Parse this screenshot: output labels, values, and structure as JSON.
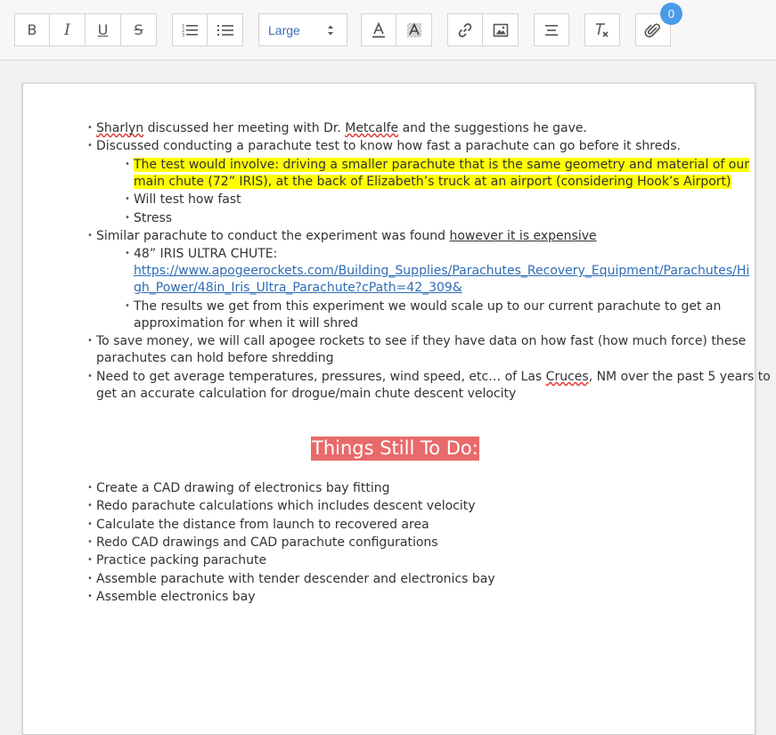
{
  "toolbar": {
    "format_size": "Large",
    "attachment_count": "0",
    "icons": [
      "bold-icon",
      "italic-icon",
      "underline-icon",
      "strikethrough-icon",
      "ordered-list-icon",
      "unordered-list-icon",
      "text-color-icon",
      "background-color-icon",
      "link-icon",
      "image-icon",
      "align-icon",
      "clear-format-icon",
      "attachment-icon"
    ],
    "labels": {
      "bold": "B",
      "italic": "I",
      "underline": "U",
      "strike": "S"
    }
  },
  "document": {
    "notes": {
      "l1_a": "Sharlyn",
      "l1_b": " discussed her meeting with Dr. ",
      "l1_c": "Metcalfe",
      "l1_d": " and the suggestions he gave.",
      "l2": "Discussed conducting a parachute test to know how fast a parachute can go before it shreds.",
      "l3_1": "The test would involve: driving a smaller parachute that is the same geometry and material of our",
      "l3_2": "main chute (72” IRIS), at the back of Elizabeth’s truck at an airport (considering Hook’s Airport)",
      "l4": "Will test how fast",
      "l5": "Stress",
      "l6_a": "Similar parachute to conduct the experiment was found ",
      "l6_b": "however it is expensive",
      "l7": "48” IRIS ULTRA CHUTE:",
      "link_1": "https://www.apogeerockets.com/Building_Supplies/Parachutes_Recovery_Equipment/Parachutes/Hi",
      "link_2": "gh_Power/48in_Iris_Ultra_Parachute?cPath=42_309&",
      "l8_1": "The results we get from this experiment we would scale up to our current parachute to get an",
      "l8_2": "approximation for when it will shred",
      "l9_1": "To save money, we will call apogee rockets to see if they have data on how fast (how much force) these",
      "l9_2": "parachutes can hold before shredding",
      "l10_1a": "Need to get average temperatures, pressures, wind speed, etc… of Las ",
      "l10_1b": "Cruces",
      "l10_1c": ", NM over the past 5 years to",
      "l10_2": "get an accurate calculation for drogue/main chute descent velocity"
    },
    "heading": "Things Still To Do:",
    "todo": [
      "Create a CAD drawing of electronics bay fitting",
      "Redo parachute calculations which includes descent velocity",
      "Calculate the distance from launch to recovered area",
      "Redo CAD drawings and CAD parachute configurations",
      "Practice packing parachute",
      "Assemble parachute with tender descender and electronics bay",
      "Assemble electronics bay"
    ],
    "bullet_char": "•"
  }
}
